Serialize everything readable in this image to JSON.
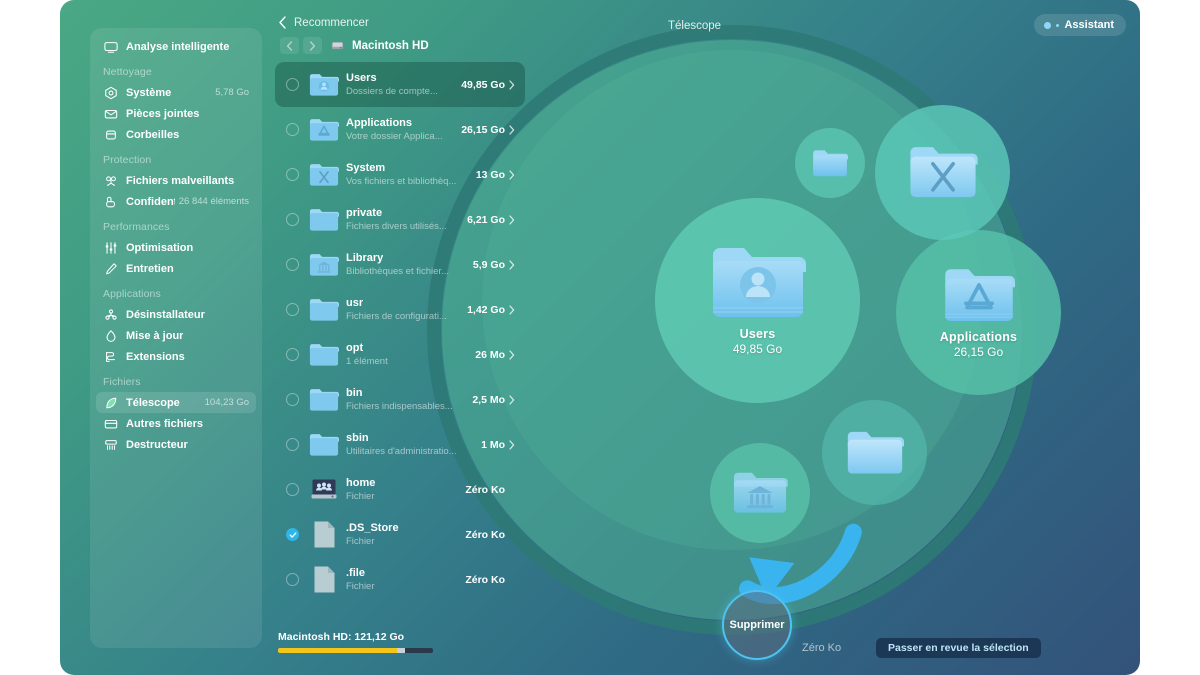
{
  "app": {
    "title": "Télescope",
    "assistant_label": "Assistant"
  },
  "colors": {
    "accent_blue": "#2fb6e8",
    "arrow_blue": "#3ab4ef",
    "bg_green": "#4aa884",
    "bg_blue": "#33527a",
    "disk_used": "#f5c518",
    "disk_other": "#c9d2d8",
    "disk_free": "#2b3a4a"
  },
  "sidebar": {
    "top_item": {
      "label": "Analyse intelligente",
      "icon": "smart-scan-icon",
      "value": ""
    },
    "groups": [
      {
        "title": "Nettoyage",
        "items": [
          {
            "label": "Système",
            "icon": "system-junk-icon",
            "value": "5,78 Go",
            "active": false
          },
          {
            "label": "Pièces jointes",
            "icon": "mail-attachments-icon",
            "value": "",
            "active": false
          },
          {
            "label": "Corbeilles",
            "icon": "trash-bins-icon",
            "value": "",
            "active": false
          }
        ]
      },
      {
        "title": "Protection",
        "items": [
          {
            "label": "Fichiers malveillants",
            "icon": "malware-icon",
            "value": "",
            "active": false
          },
          {
            "label": "Confident...",
            "icon": "privacy-icon",
            "value": "26 844 éléments",
            "active": false
          }
        ]
      },
      {
        "title": "Performances",
        "items": [
          {
            "label": "Optimisation",
            "icon": "optimization-icon",
            "value": "",
            "active": false
          },
          {
            "label": "Entretien",
            "icon": "maintenance-icon",
            "value": "",
            "active": false
          }
        ]
      },
      {
        "title": "Applications",
        "items": [
          {
            "label": "Désinstallateur",
            "icon": "uninstaller-icon",
            "value": "",
            "active": false
          },
          {
            "label": "Mise à jour",
            "icon": "updater-icon",
            "value": "",
            "active": false
          },
          {
            "label": "Extensions",
            "icon": "extensions-icon",
            "value": "",
            "active": false
          }
        ]
      },
      {
        "title": "Fichiers",
        "items": [
          {
            "label": "Télescope",
            "icon": "space-lens-icon",
            "value": "104,23 Go",
            "active": true
          },
          {
            "label": "Autres fichiers",
            "icon": "other-files-icon",
            "value": "",
            "active": false
          },
          {
            "label": "Destructeur",
            "icon": "shredder-icon",
            "value": "",
            "active": false
          }
        ]
      }
    ]
  },
  "list": {
    "restart_label": "Recommencer",
    "breadcrumb": "Macintosh HD",
    "back_icon": "chevron-left-icon",
    "forward_icon": "chevron-right-icon",
    "disk_icon": "hard-drive-icon",
    "rows": [
      {
        "name": "Users",
        "sub": "Dossiers de compte...",
        "size": "49,85 Go",
        "icon": "folder-users-icon",
        "checked": false,
        "selected": true,
        "chevron": true
      },
      {
        "name": "Applications",
        "sub": "Votre dossier Applica...",
        "size": "26,15 Go",
        "icon": "folder-applications-icon",
        "checked": false,
        "selected": false,
        "chevron": true
      },
      {
        "name": "System",
        "sub": "Vos fichiers et bibliothèq...",
        "size": "13 Go",
        "icon": "folder-system-icon",
        "checked": false,
        "selected": false,
        "chevron": true
      },
      {
        "name": "private",
        "sub": "Fichiers divers utilisés...",
        "size": "6,21 Go",
        "icon": "folder-plain-icon",
        "checked": false,
        "selected": false,
        "chevron": true
      },
      {
        "name": "Library",
        "sub": "Bibliothèques et fichier...",
        "size": "5,9 Go",
        "icon": "folder-library-icon",
        "checked": false,
        "selected": false,
        "chevron": true
      },
      {
        "name": "usr",
        "sub": "Fichiers de configurati...",
        "size": "1,42 Go",
        "icon": "folder-plain-icon",
        "checked": false,
        "selected": false,
        "chevron": true
      },
      {
        "name": "opt",
        "sub": "1 élément",
        "size": "26 Mo",
        "icon": "folder-plain-icon",
        "checked": false,
        "selected": false,
        "chevron": true
      },
      {
        "name": "bin",
        "sub": "Fichiers indispensables...",
        "size": "2,5 Mo",
        "icon": "folder-plain-icon",
        "checked": false,
        "selected": false,
        "chevron": true
      },
      {
        "name": "sbin",
        "sub": "Utilitaires d'administratio...",
        "size": "1 Mo",
        "icon": "folder-plain-icon",
        "checked": false,
        "selected": false,
        "chevron": true
      },
      {
        "name": "home",
        "sub": "Fichier",
        "size": "Zéro Ko",
        "icon": "network-drive-icon",
        "checked": false,
        "selected": false,
        "chevron": false
      },
      {
        "name": ".DS_Store",
        "sub": "Fichier",
        "size": "Zéro Ko",
        "icon": "generic-file-icon",
        "checked": true,
        "selected": false,
        "chevron": false
      },
      {
        "name": ".file",
        "sub": "Fichier",
        "size": "Zéro Ko",
        "icon": "generic-file-icon",
        "checked": false,
        "selected": false,
        "chevron": false
      }
    ],
    "disk": {
      "label": "Macintosh HD: 121,12 Go",
      "used_pct": 77,
      "other_pct": 5,
      "free_pct": 18
    }
  },
  "visualization": {
    "bubbles": [
      {
        "key": "users",
        "label": "Users",
        "size": "49,85 Go",
        "icon": "folder-users-icon"
      },
      {
        "key": "applications",
        "label": "Applications",
        "size": "26,15 Go",
        "icon": "folder-applications-icon"
      },
      {
        "key": "system",
        "label": "",
        "size": "",
        "icon": "folder-system-icon"
      },
      {
        "key": "private",
        "label": "",
        "size": "",
        "icon": "folder-plain-icon"
      },
      {
        "key": "library",
        "label": "",
        "size": "",
        "icon": "folder-library-icon"
      },
      {
        "key": "usr",
        "label": "",
        "size": "",
        "icon": "folder-plain-icon"
      }
    ]
  },
  "actions": {
    "delete_label": "Supprimer",
    "selected_size": "Zéro Ko",
    "review_label": "Passer en revue la sélection"
  }
}
